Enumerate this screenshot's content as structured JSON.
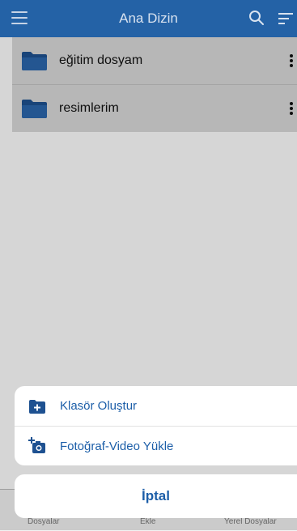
{
  "header": {
    "title": "Ana Dizin"
  },
  "folders": [
    {
      "name": "eğitim dosyam"
    },
    {
      "name": "resimlerim"
    }
  ],
  "bottom_tabs": [
    "Dosyalar",
    "Ekle",
    "Yerel Dosyalar"
  ],
  "action_sheet": {
    "items": [
      {
        "label": "Klasör Oluştur",
        "icon": "folder-plus-icon"
      },
      {
        "label": "Fotoğraf-Video Yükle",
        "icon": "camera-plus-icon"
      }
    ],
    "cancel_label": "İptal"
  },
  "colors": {
    "header": "#2462a6",
    "accent": "#1c5ea8",
    "folder": "#1e5191"
  }
}
